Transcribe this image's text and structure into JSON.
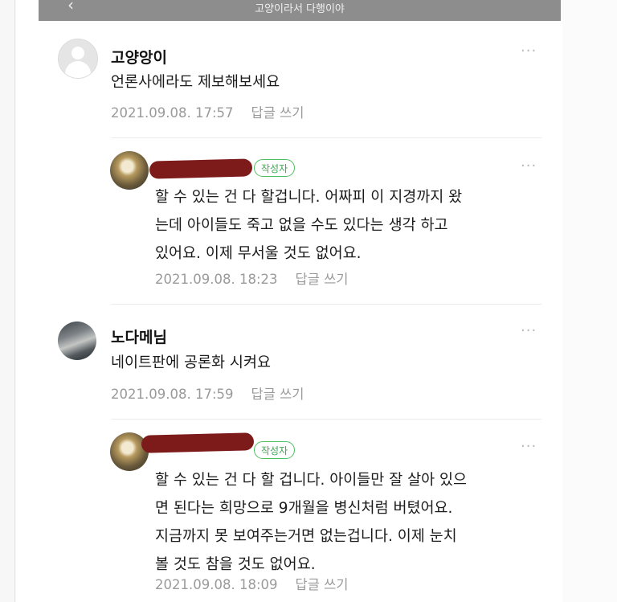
{
  "header": {
    "title": "고양이라서 다행이야",
    "back_glyph": "‹"
  },
  "comments": [
    {
      "nickname": "고양앙이",
      "text": "언론사에라도 제보해보세요",
      "date": "2021.09.08. 17:57",
      "reply_label": "답글 쓰기",
      "more": "···"
    },
    {
      "badge": "작성자",
      "text": "할 수 있는 건 다 할겁니다. 어짜피 이 지경까지 왔\n는데 아이들도 죽고 없을 수도 있다는 생각 하고\n있어요. 이제 무서울 것도 없어요.",
      "date": "2021.09.08. 18:23",
      "reply_label": "답글 쓰기",
      "more": "···"
    },
    {
      "nickname": "노다메님",
      "text": "네이트판에 공론화 시켜요",
      "date": "2021.09.08. 17:59",
      "reply_label": "답글 쓰기",
      "more": "···"
    },
    {
      "badge": "작성자",
      "text": "할 수 있는 건 다 할 겁니다. 아이들만 잘 살아 있으\n면 된다는 희망으로 9개월을 병신처럼 버텼어요.\n지금까지 못 보여주는거면 없는겁니다. 이제 눈치\n볼 것도 참을 것도 없어요.",
      "date": "2021.09.08. 18:09",
      "reply_label": "답글 쓰기",
      "more": "···"
    }
  ],
  "colors": {
    "badge_green": "#3ea751",
    "redaction": "#7d1a1a",
    "meta_gray": "#9a9a9a"
  }
}
